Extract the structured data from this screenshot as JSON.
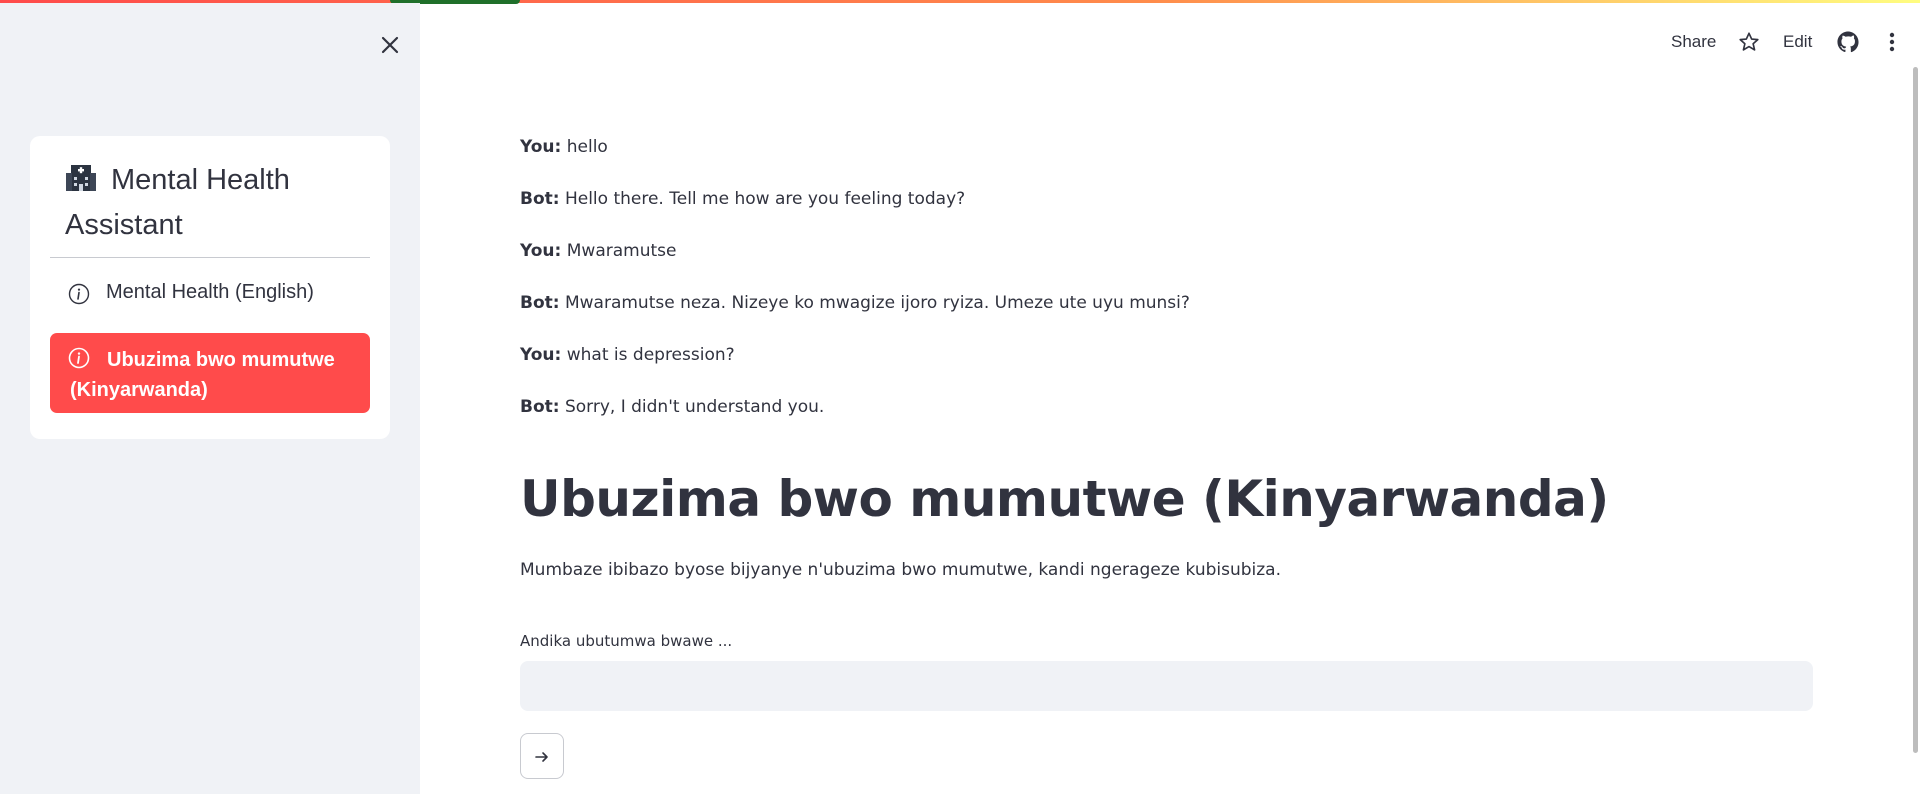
{
  "colors": {
    "accent": "#ff4b4b",
    "sidebar_bg": "#f0f2f6",
    "text": "#31333f"
  },
  "sidebar": {
    "close_icon": "close-icon",
    "app_icon": "hospital-icon",
    "title": "Mental Health Assistant",
    "items": [
      {
        "label": "Mental Health (English)",
        "icon": "info-icon",
        "active": false
      },
      {
        "label": "Ubuzima bwo mumutwe (Kinyarwanda)",
        "icon": "info-icon",
        "active": true
      }
    ]
  },
  "toolbar": {
    "share_label": "Share",
    "star_icon": "star-icon",
    "edit_label": "Edit",
    "github_icon": "github-icon",
    "menu_icon": "more-vertical-icon"
  },
  "chat": {
    "messages": [
      {
        "speaker": "You:",
        "text": "hello"
      },
      {
        "speaker": "Bot:",
        "text": "Hello there. Tell me how are you feeling today?"
      },
      {
        "speaker": "You:",
        "text": "Mwaramutse"
      },
      {
        "speaker": "Bot:",
        "text": "Mwaramutse neza. Nizeye ko mwagize ijoro ryiza. Umeze ute uyu munsi?"
      },
      {
        "speaker": "You:",
        "text": "what is depression?"
      },
      {
        "speaker": "Bot:",
        "text": "Sorry, I didn't understand you."
      }
    ]
  },
  "main": {
    "title": "Ubuzima bwo mumutwe (Kinyarwanda)",
    "description": "Mumbaze ibibazo byose bijyanye n'ubuzima bwo mumutwe, kandi ngerageze kubisubiza.",
    "input_label": "Andika ubutumwa bwawe ...",
    "input_value": "",
    "send_icon": "arrow-right-icon"
  }
}
